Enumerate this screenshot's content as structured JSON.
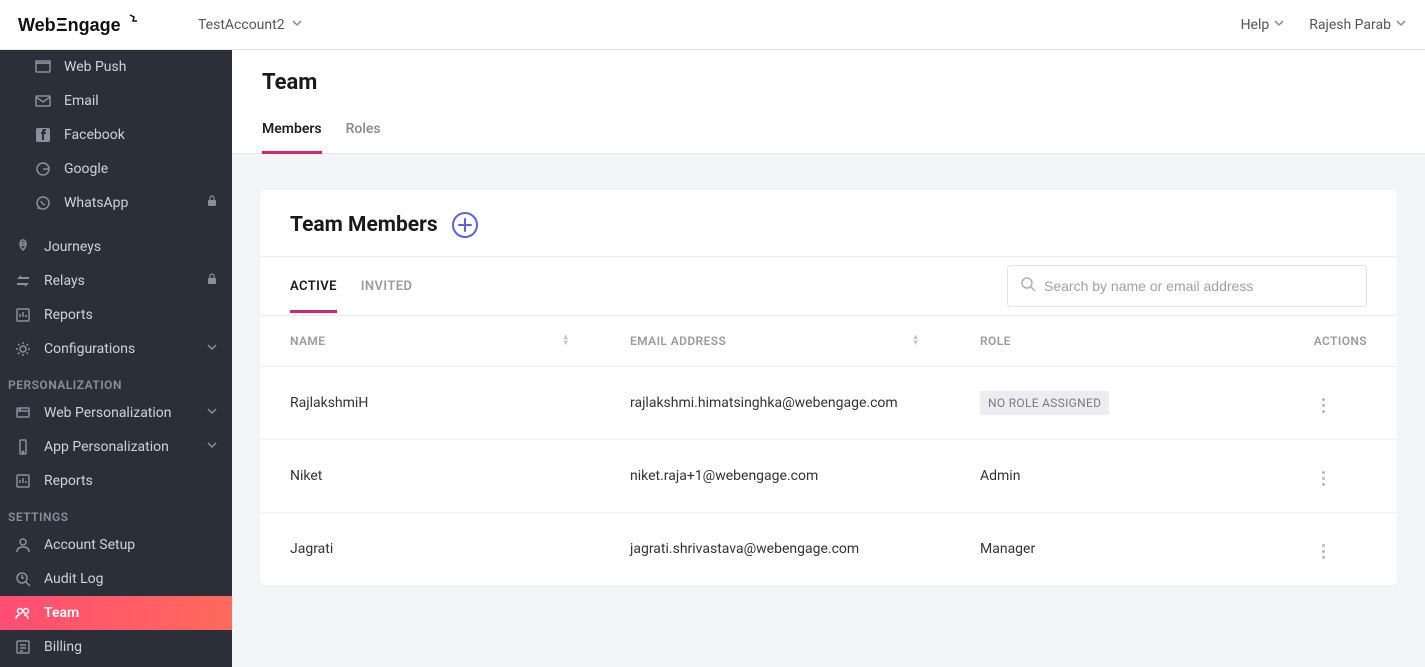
{
  "topbar": {
    "account_name": "TestAccount2",
    "help_label": "Help",
    "user_name": "Rajesh Parab"
  },
  "sidebar": {
    "channels": [
      {
        "label": "Web Push",
        "icon": "web-push-icon"
      },
      {
        "label": "Email",
        "icon": "email-icon"
      },
      {
        "label": "Facebook",
        "icon": "facebook-icon"
      },
      {
        "label": "Google",
        "icon": "google-icon"
      },
      {
        "label": "WhatsApp",
        "icon": "whatsapp-icon",
        "locked": true
      }
    ],
    "main": [
      {
        "label": "Journeys",
        "icon": "journeys-icon"
      },
      {
        "label": "Relays",
        "icon": "relays-icon",
        "locked": true
      },
      {
        "label": "Reports",
        "icon": "reports-icon"
      },
      {
        "label": "Configurations",
        "icon": "configurations-icon",
        "chevron": true
      }
    ],
    "section_personalization": "PERSONALIZATION",
    "personalization": [
      {
        "label": "Web Personalization",
        "icon": "web-personalization-icon",
        "chevron": true
      },
      {
        "label": "App Personalization",
        "icon": "app-personalization-icon",
        "chevron": true
      },
      {
        "label": "Reports",
        "icon": "reports-icon"
      }
    ],
    "section_settings": "SETTINGS",
    "settings": [
      {
        "label": "Account Setup",
        "icon": "account-setup-icon"
      },
      {
        "label": "Audit Log",
        "icon": "audit-log-icon"
      },
      {
        "label": "Team",
        "icon": "team-icon",
        "active": true
      },
      {
        "label": "Billing",
        "icon": "billing-icon"
      }
    ]
  },
  "page": {
    "title": "Team",
    "tabs": [
      {
        "label": "Members",
        "active": true
      },
      {
        "label": "Roles",
        "active": false
      }
    ]
  },
  "card": {
    "title": "Team Members",
    "sub_tabs": [
      {
        "label": "ACTIVE",
        "active": true
      },
      {
        "label": "INVITED",
        "active": false
      }
    ],
    "search_placeholder": "Search by name or email address",
    "columns": {
      "name": "NAME",
      "email": "EMAIL ADDRESS",
      "role": "ROLE",
      "actions": "ACTIONS"
    },
    "no_role_label": "NO ROLE ASSIGNED",
    "rows": [
      {
        "name": "RajlakshmiH",
        "email": "rajlakshmi.himatsinghka@webengage.com",
        "role": null
      },
      {
        "name": "Niket",
        "email": "niket.raja+1@webengage.com",
        "role": "Admin"
      },
      {
        "name": "Jagrati",
        "email": "jagrati.shrivastava@webengage.com",
        "role": "Manager"
      }
    ]
  }
}
